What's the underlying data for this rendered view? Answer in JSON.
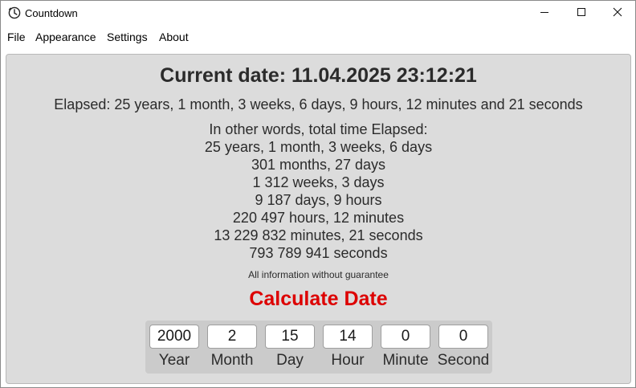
{
  "window": {
    "title": "Countdown",
    "controls": {
      "minimize": "minimize",
      "maximize": "maximize",
      "close": "close"
    }
  },
  "menu": [
    "File",
    "Appearance",
    "Settings",
    "About"
  ],
  "main": {
    "current_date": "Current date: 11.04.2025 23:12:21",
    "elapsed": "Elapsed: 25 years, 1 month, 3 weeks, 6 days, 9 hours, 12 minutes and 21 seconds",
    "other_words_heading": "In other words, total time Elapsed:",
    "breakdown": [
      "25 years, 1 month, 3 weeks, 6 days",
      "301 months, 27 days",
      "1 312 weeks, 3 days",
      "9 187 days, 9 hours",
      "220 497 hours, 12 minutes",
      "13 229 832 minutes, 21 seconds",
      "793 789 941 seconds"
    ],
    "disclaimer": "All information without guarantee",
    "calculate_title": "Calculate Date"
  },
  "inputs": [
    {
      "label": "Year",
      "value": "2000"
    },
    {
      "label": "Month",
      "value": "2"
    },
    {
      "label": "Day",
      "value": "15"
    },
    {
      "label": "Hour",
      "value": "14"
    },
    {
      "label": "Minute",
      "value": "0"
    },
    {
      "label": "Second",
      "value": "0"
    }
  ],
  "colors": {
    "panel_background": "#dcdcdc",
    "calculate_title": "#dd0000",
    "inputs_background": "#cbcbcb"
  },
  "icons": [
    "clock-icon",
    "minimize-icon",
    "maximize-icon",
    "close-icon"
  ]
}
